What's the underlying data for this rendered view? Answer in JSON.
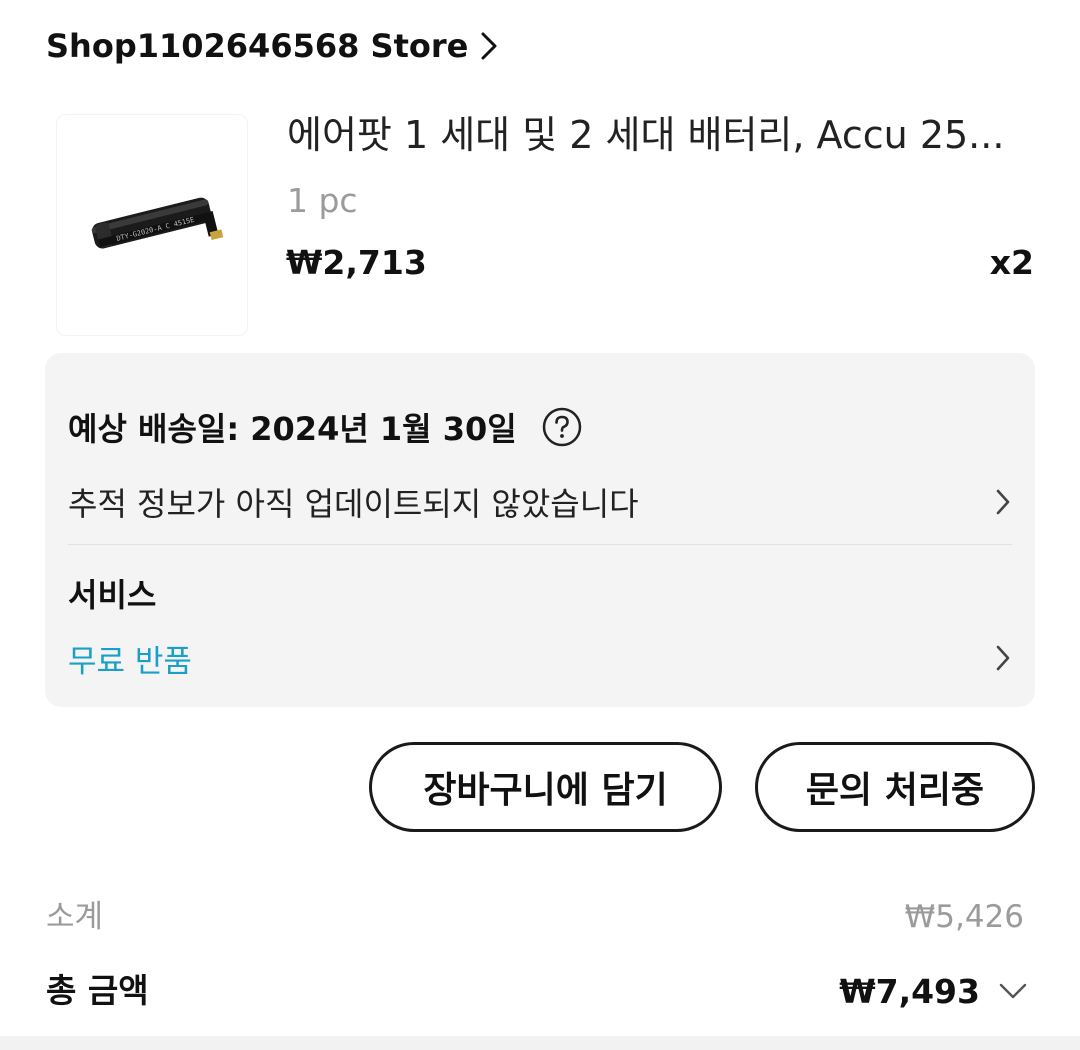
{
  "store": {
    "name": "Shop1102646568 Store",
    "arrow_icon": "chevron-right-icon"
  },
  "product": {
    "title": "에어팟 1 세대 및 2 세대 배터리, Accu 25...",
    "variant": "1 pc",
    "price": "₩2,713",
    "quantity": "x2",
    "image_icon": "battery-product-image",
    "image_text": "DTY-G2020-A C 4515E"
  },
  "info": {
    "delivery_label": "예상 배송일: 2024년 1월 30일",
    "help_icon": "question-circle-icon",
    "tracking_text": "추적 정보가 아직 업데이트되지 않았습니다",
    "service_title": "서비스",
    "service_text": "무료 반품",
    "service_color": "#1a9fc9"
  },
  "actions": {
    "add_to_cart": "장바구니에 담기",
    "inquiry": "문의 처리중"
  },
  "totals": {
    "subtotal_label": "소계",
    "subtotal_value": "₩5,426",
    "total_label": "총 금액",
    "total_value": "₩7,493",
    "expand_icon": "chevron-down-icon"
  }
}
